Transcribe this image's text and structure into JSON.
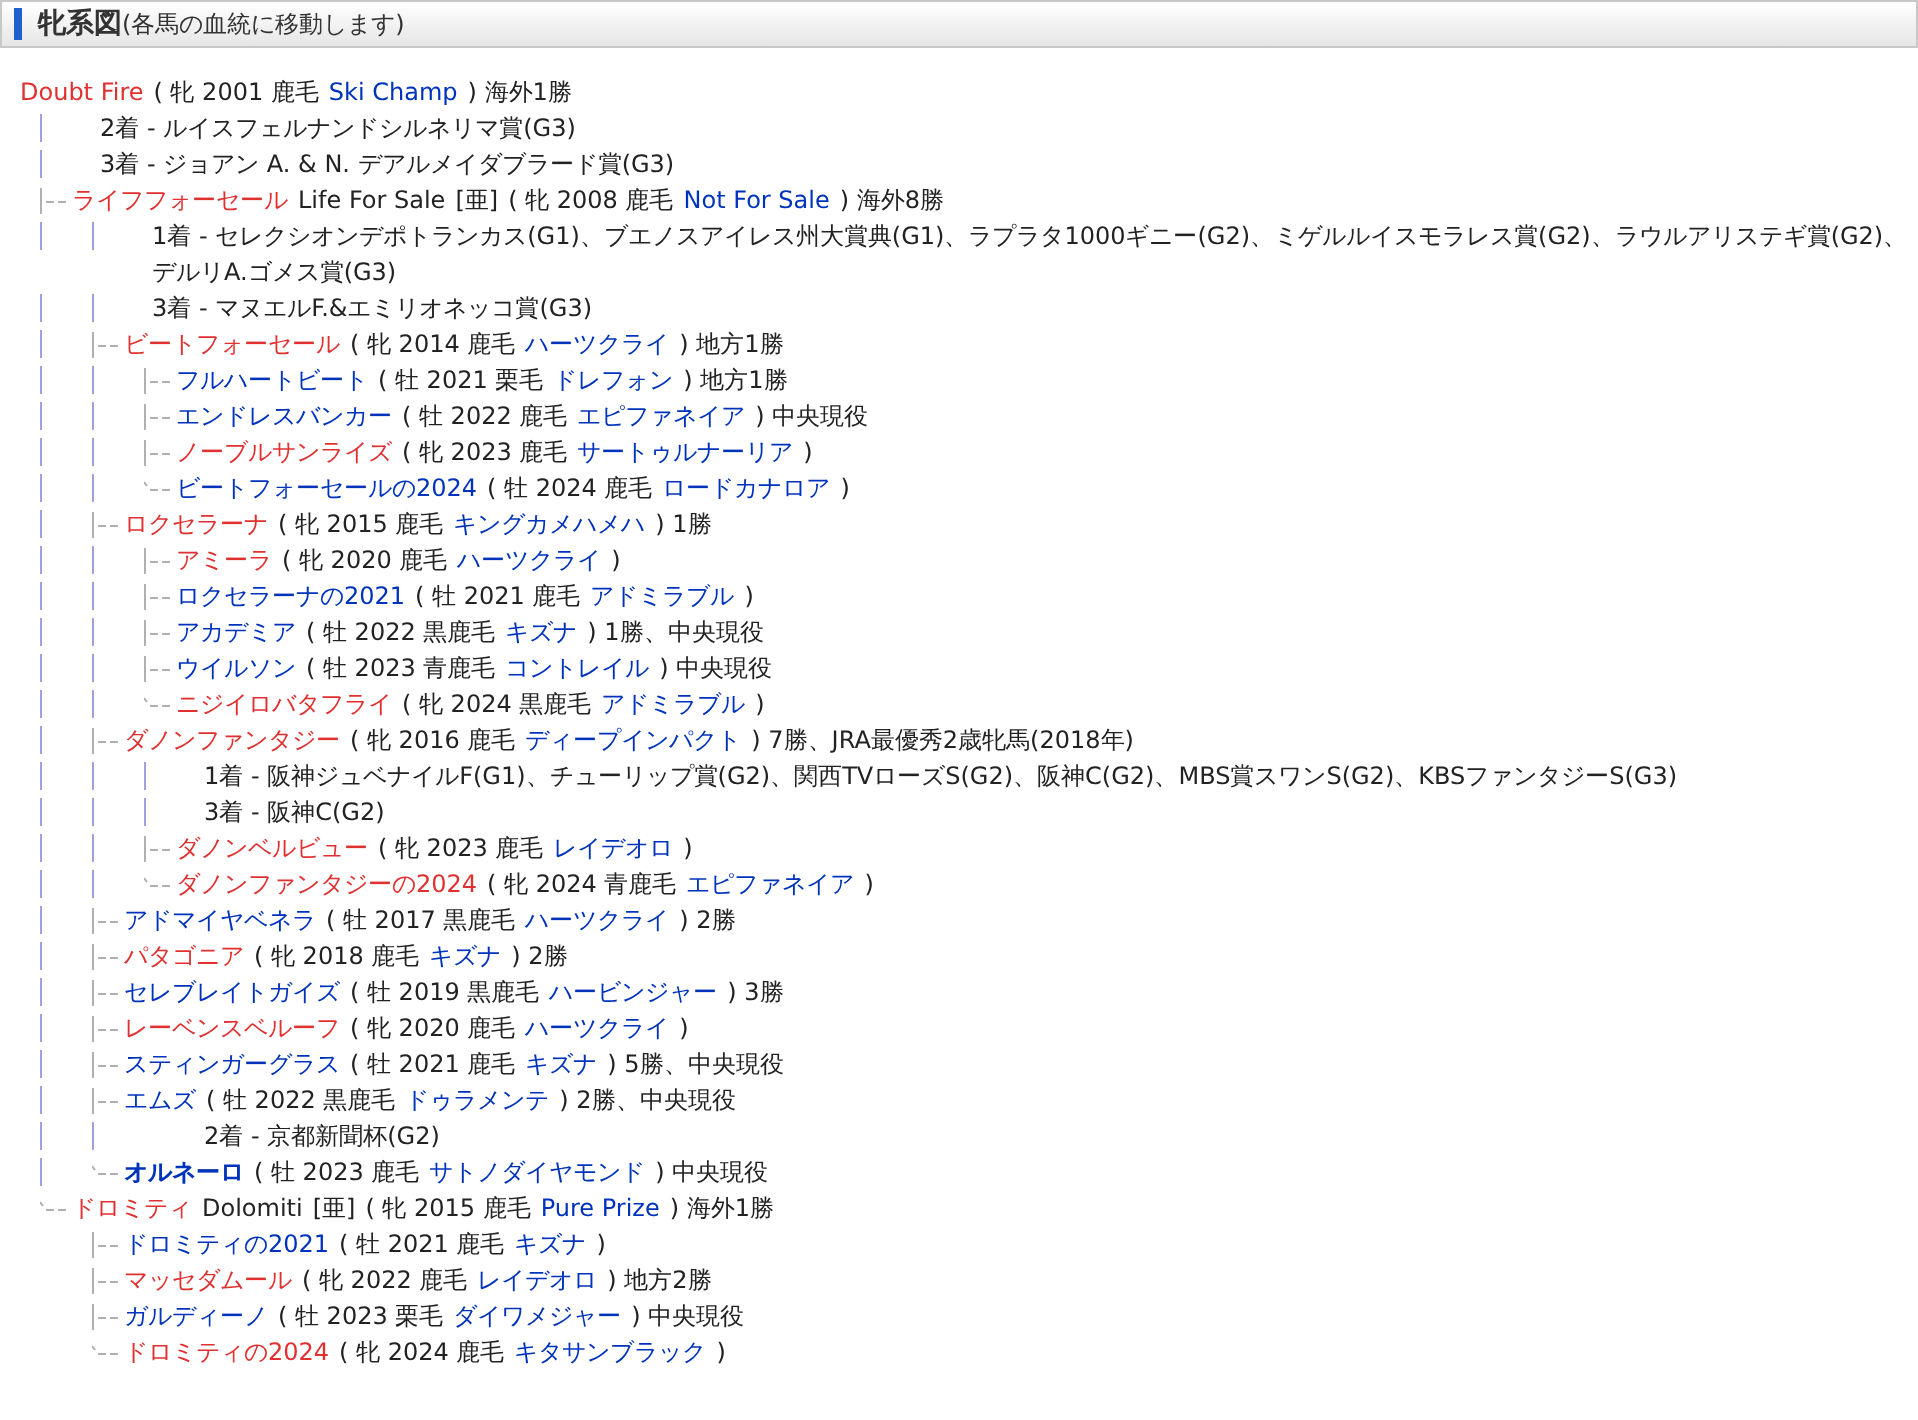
{
  "header": {
    "title": "牝系図",
    "subtitle": "(各馬の血統に移動します)"
  },
  "tree": {
    "name": "Doubt Fire",
    "color": "#e03030",
    "bold": false,
    "profile": "( 牝 2001 鹿毛",
    "sire": "Ski Champ",
    "result": ") 海外1勝",
    "records": [
      "2着 - ルイスフェルナンドシルネリマ賞(G3)",
      "3着 - ジョアン A. & N. デアルメイダブラード賞(G3)"
    ],
    "children": [
      {
        "name": "ライフフォーセール",
        "color": "#e03030",
        "bold": false,
        "name_en": "Life For Sale",
        "origin": "[亜]",
        "profile": "( 牝 2008 鹿毛",
        "sire": "Not For Sale",
        "result": ") 海外8勝",
        "records": [
          "1着 - セレクシオンデポトランカス(G1)、ブエノスアイレス州大賞典(G1)、ラプラタ1000ギニー(G2)、ミゲルルイスモラレス賞(G2)、ラウルアリステギ賞(G2)、デルリA.ゴメス賞(G3)",
          "3着 - マヌエルF.&エミリオネッコ賞(G3)"
        ],
        "children": [
          {
            "name": "ビートフォーセール",
            "color": "#e03030",
            "bold": false,
            "profile": "( 牝 2014 鹿毛",
            "sire": "ハーツクライ",
            "result": ") 地方1勝",
            "children": [
              {
                "name": "フルハートビート",
                "color": "#0033bb",
                "bold": false,
                "profile": "( 牡 2021 栗毛",
                "sire": "ドレフォン",
                "result": ") 地方1勝"
              },
              {
                "name": "エンドレスバンカー",
                "color": "#0033bb",
                "bold": false,
                "profile": "( 牡 2022 鹿毛",
                "sire": "エピファネイア",
                "result": ") 中央現役"
              },
              {
                "name": "ノーブルサンライズ",
                "color": "#e03030",
                "bold": false,
                "profile": "( 牝 2023 鹿毛",
                "sire": "サートゥルナーリア",
                "result": ")"
              },
              {
                "name": "ビートフォーセールの2024",
                "color": "#0033bb",
                "bold": false,
                "profile": "( 牡 2024 鹿毛",
                "sire": "ロードカナロア",
                "result": ")"
              }
            ]
          },
          {
            "name": "ロクセラーナ",
            "color": "#e03030",
            "bold": false,
            "profile": "( 牝 2015 鹿毛",
            "sire": "キングカメハメハ",
            "result": ") 1勝",
            "children": [
              {
                "name": "アミーラ",
                "color": "#e03030",
                "bold": false,
                "profile": "( 牝 2020 鹿毛",
                "sire": "ハーツクライ",
                "result": ")"
              },
              {
                "name": "ロクセラーナの2021",
                "color": "#0033bb",
                "bold": false,
                "profile": "( 牡 2021 鹿毛",
                "sire": "アドミラブル",
                "result": ")"
              },
              {
                "name": "アカデミア",
                "color": "#0033bb",
                "bold": false,
                "profile": "( 牡 2022 黒鹿毛",
                "sire": "キズナ",
                "result": ") 1勝、中央現役"
              },
              {
                "name": "ウイルソン",
                "color": "#0033bb",
                "bold": false,
                "profile": "( 牡 2023 青鹿毛",
                "sire": "コントレイル",
                "result": ") 中央現役"
              },
              {
                "name": "ニジイロバタフライ",
                "color": "#e03030",
                "bold": false,
                "profile": "( 牝 2024 黒鹿毛",
                "sire": "アドミラブル",
                "result": ")"
              }
            ]
          },
          {
            "name": "ダノンファンタジー",
            "color": "#e03030",
            "bold": false,
            "profile": "( 牝 2016 鹿毛",
            "sire": "ディープインパクト",
            "result": ") 7勝、JRA最優秀2歳牝馬(2018年)",
            "records": [
              "1着 - 阪神ジュベナイルF(G1)、チューリップ賞(G2)、関西TVローズS(G2)、阪神C(G2)、MBS賞スワンS(G2)、KBSファンタジーS(G3)",
              "3着 - 阪神C(G2)"
            ],
            "children": [
              {
                "name": "ダノンベルビュー",
                "color": "#e03030",
                "bold": false,
                "profile": "( 牝 2023 鹿毛",
                "sire": "レイデオロ",
                "result": ")"
              },
              {
                "name": "ダノンファンタジーの2024",
                "color": "#e03030",
                "bold": false,
                "profile": "( 牝 2024 青鹿毛",
                "sire": "エピファネイア",
                "result": ")"
              }
            ]
          },
          {
            "name": "アドマイヤベネラ",
            "color": "#0033bb",
            "bold": false,
            "profile": "( 牡 2017 黒鹿毛",
            "sire": "ハーツクライ",
            "result": ") 2勝"
          },
          {
            "name": "パタゴニア",
            "color": "#e03030",
            "bold": false,
            "profile": "( 牝 2018 鹿毛",
            "sire": "キズナ",
            "result": ") 2勝"
          },
          {
            "name": "セレブレイトガイズ",
            "color": "#0033bb",
            "bold": false,
            "profile": "( 牡 2019 黒鹿毛",
            "sire": "ハービンジャー",
            "result": ") 3勝"
          },
          {
            "name": "レーベンスベルーフ",
            "color": "#e03030",
            "bold": false,
            "profile": "( 牝 2020 鹿毛",
            "sire": "ハーツクライ",
            "result": ")"
          },
          {
            "name": "スティンガーグラス",
            "color": "#0033bb",
            "bold": false,
            "profile": "( 牡 2021 鹿毛",
            "sire": "キズナ",
            "result": ") 5勝、中央現役"
          },
          {
            "name": "エムズ",
            "color": "#0033bb",
            "bold": false,
            "profile": "( 牡 2022 黒鹿毛",
            "sire": "ドゥラメンテ",
            "result": ") 2勝、中央現役",
            "records": [
              "2着 - 京都新聞杯(G2)"
            ]
          },
          {
            "name": "オルネーロ",
            "color": "#0033bb",
            "bold": true,
            "profile": "( 牡 2023 鹿毛",
            "sire": "サトノダイヤモンド",
            "result": ") 中央現役"
          }
        ]
      },
      {
        "name": "ドロミティ",
        "color": "#e03030",
        "bold": false,
        "name_en": "Dolomiti",
        "origin": "[亜]",
        "profile": "( 牝 2015 鹿毛",
        "sire": "Pure Prize",
        "result": ") 海外1勝",
        "children": [
          {
            "name": "ドロミティの2021",
            "color": "#0033bb",
            "bold": false,
            "profile": "( 牡 2021 鹿毛",
            "sire": "キズナ",
            "result": ")"
          },
          {
            "name": "マッセダムール",
            "color": "#e03030",
            "bold": false,
            "profile": "( 牝 2022 鹿毛",
            "sire": "レイデオロ",
            "result": ") 地方2勝"
          },
          {
            "name": "ガルディーノ",
            "color": "#0033bb",
            "bold": false,
            "profile": "( 牡 2023 栗毛",
            "sire": "ダイワメジャー",
            "result": ") 中央現役"
          },
          {
            "name": "ドロミティの2024",
            "color": "#e03030",
            "bold": false,
            "profile": "( 牝 2024 鹿毛",
            "sire": "キタサンブラック",
            "result": ")"
          }
        ]
      }
    ]
  }
}
